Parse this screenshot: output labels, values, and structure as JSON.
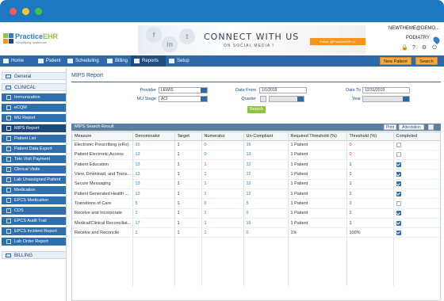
{
  "brand": {
    "name_a": "Practice",
    "name_b": "EHR",
    "tagline": "Simplifying healthcare"
  },
  "banner": {
    "title": "CONNECT WITH US",
    "subtitle": "ON SOCIAL MEDIA !",
    "follow": "Follow @PracticeEHR >>"
  },
  "user": {
    "name": "NEWTHEME@DEMO...",
    "role": "PODIATRY"
  },
  "nav": {
    "items": [
      "Home",
      "Patient",
      "Scheduling",
      "Billing",
      "Reports",
      "Setup"
    ],
    "new_patient": "New Patient",
    "search": "Search"
  },
  "sidebar": {
    "general": "General",
    "clinical": "CLINICAL",
    "items": [
      "Immunization",
      "eCQM",
      "MU Report",
      "MIPS Report",
      "Patient List",
      "Patient Data Export",
      "Tele Visit Payment",
      "Clinical Visits",
      "Lab Unassigned Patient",
      "Medication",
      "EPCS Medication",
      "CDS",
      "EPCS Audit Trail",
      "EPCS Incident Report",
      "Lab Order Report"
    ],
    "billing": "BILLING"
  },
  "page": {
    "title": "MIPS Report"
  },
  "filters": {
    "provider_label": "Provider",
    "provider_value": "LEWIS",
    "mu_stage_label": "MU Stage",
    "mu_stage_value": "ACI",
    "date_from_label": "Date From",
    "date_from_value": "1/1/2019",
    "quarter_label": "Quarter",
    "date_to_label": "Date To",
    "date_to_value": "12/31/2019",
    "year_label": "Year",
    "search_label": "Search"
  },
  "results": {
    "title": "MIPS Search Result",
    "print_label": "Print",
    "attestation_label": "Attestation",
    "columns": [
      "Measure",
      "Denominator",
      "Target",
      "Numerator",
      "Un-Compliant",
      "Required Threshold (%)",
      "Threshold (%)",
      "Completed"
    ],
    "rows": [
      {
        "measure": "Electronic Prescribing (eRx)",
        "denominator": "16",
        "target": "1",
        "numerator": "0",
        "uncompliant": "16",
        "required": "1 Patient",
        "threshold": "0",
        "completed": false
      },
      {
        "measure": "Patient Electronic Access",
        "denominator": "13",
        "target": "1",
        "numerator": "0",
        "uncompliant": "13",
        "required": "1 Patient",
        "threshold": "0",
        "completed": false
      },
      {
        "measure": "Patient Education",
        "denominator": "13",
        "target": "1",
        "numerator": "1",
        "uncompliant": "12",
        "required": "1 Patient",
        "threshold": "1",
        "completed": true
      },
      {
        "measure": "View, Download, and Trans...",
        "denominator": "13",
        "target": "1",
        "numerator": "1",
        "uncompliant": "12",
        "required": "1 Patient",
        "threshold": "1",
        "completed": true
      },
      {
        "measure": "Secure Messaging",
        "denominator": "13",
        "target": "1",
        "numerator": "1",
        "uncompliant": "12",
        "required": "1 Patient",
        "threshold": "1",
        "completed": true
      },
      {
        "measure": "Patient Generated Health ...",
        "denominator": "13",
        "target": "1",
        "numerator": "1",
        "uncompliant": "12",
        "required": "1 Patient",
        "threshold": "1",
        "completed": true
      },
      {
        "measure": "Transitions of Care",
        "denominator": "5",
        "target": "1",
        "numerator": "0",
        "uncompliant": "5",
        "required": "1 Patient",
        "threshold": "0",
        "completed": false
      },
      {
        "measure": "Receive and Incorporate",
        "denominator": "1",
        "target": "1",
        "numerator": "1",
        "uncompliant": "0",
        "required": "1 Patient",
        "threshold": "1",
        "completed": true
      },
      {
        "measure": "Medical/Clinical Reconciliat...",
        "denominator": "17",
        "target": "1",
        "numerator": "1",
        "uncompliant": "16",
        "required": "1 Patient",
        "threshold": "1",
        "completed": true
      },
      {
        "measure": "Receive and Reconcile",
        "denominator": "1",
        "target": "1",
        "numerator": "1",
        "uncompliant": "0",
        "required": "1%",
        "threshold": "100%",
        "completed": true
      }
    ]
  },
  "colors": {
    "titlebar": "#1d78c1",
    "nav": "#2e6aa8",
    "accent": "#f7a93b",
    "sidebar_item": "#2f6fae",
    "red_value": "#e0262b"
  }
}
